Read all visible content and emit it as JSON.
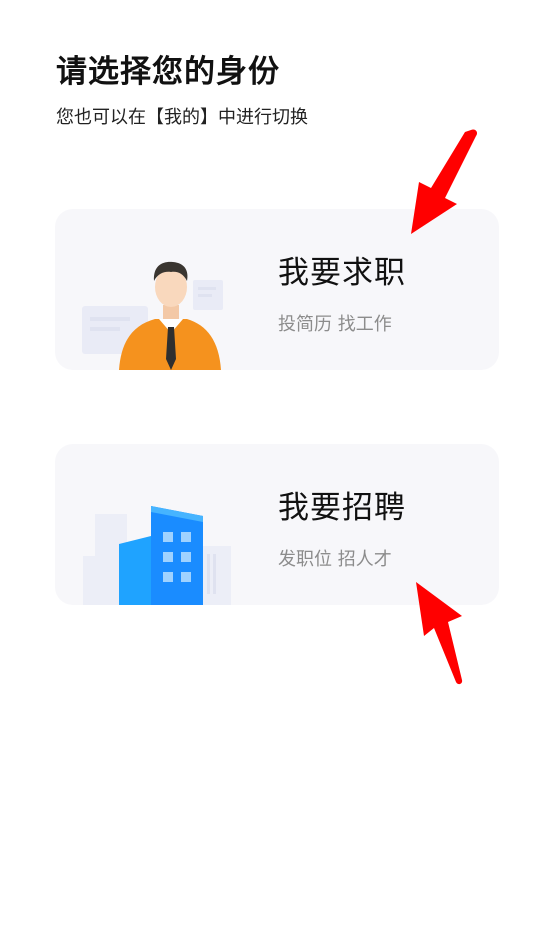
{
  "header": {
    "title": "请选择您的身份",
    "subtitle": "您也可以在【我的】中进行切换"
  },
  "options": [
    {
      "title": "我要求职",
      "subtitle": "投简历 找工作"
    },
    {
      "title": "我要招聘",
      "subtitle": "发职位 招人才"
    }
  ],
  "colors": {
    "card_bg": "#f7f7fa",
    "arrow": "#ff0000",
    "shirt": "#f5921e",
    "building": "#1a8cff"
  }
}
